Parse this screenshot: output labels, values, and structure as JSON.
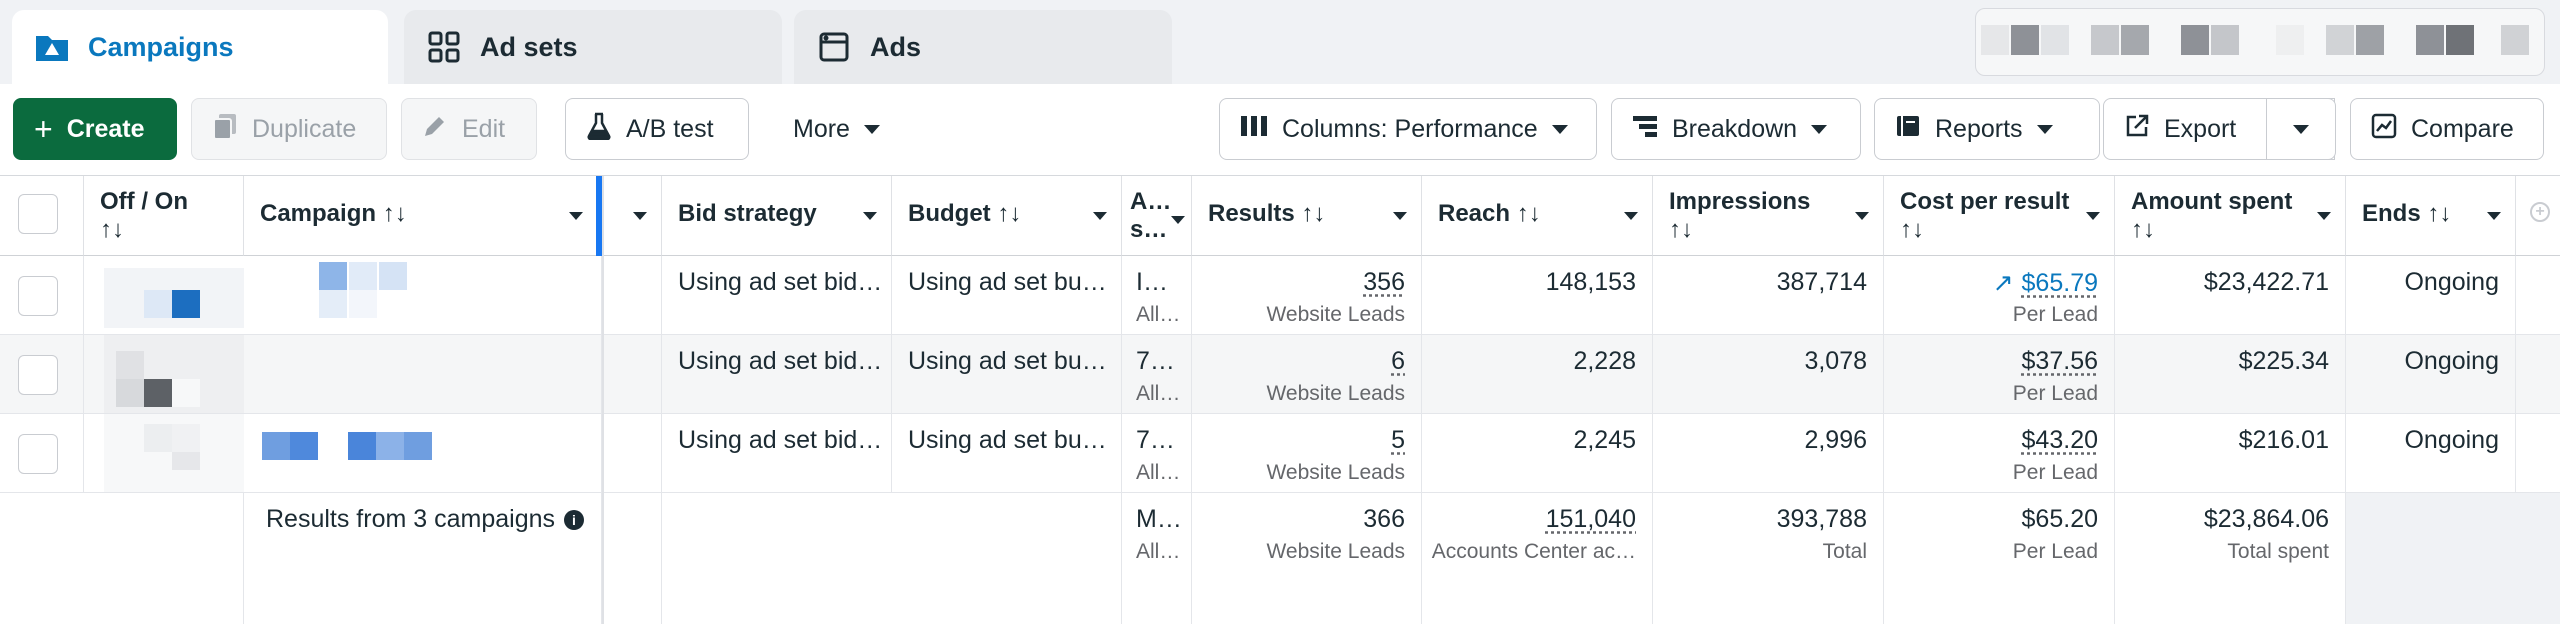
{
  "tabs": [
    {
      "label": "Campaigns",
      "icon": "campaign-folder-icon"
    },
    {
      "label": "Ad sets",
      "icon": "adsets-grid-icon"
    },
    {
      "label": "Ads",
      "icon": "ads-window-icon"
    }
  ],
  "toolbar": {
    "create": "Create",
    "duplicate": "Duplicate",
    "edit": "Edit",
    "ab_test": "A/B test",
    "more": "More",
    "columns": "Columns: Performance",
    "breakdown": "Breakdown",
    "reports": "Reports",
    "export": "Export",
    "compare": "Compare"
  },
  "table": {
    "headers": {
      "off_on": "Off / On",
      "campaign": "Campaign",
      "bid_strategy": "Bid strategy",
      "budget": "Budget",
      "attribution": "A… s…",
      "results": "Results",
      "reach": "Reach",
      "impressions": "Impressions",
      "cost_per_result": "Cost per result",
      "amount_spent": "Amount spent",
      "ends": "Ends"
    },
    "sort_glyph": "↑↓",
    "rows": [
      {
        "bid": "Using ad set bid…",
        "budget": "Using ad set bu…",
        "attr": "I…",
        "attr_sub": "All…",
        "results": "356",
        "results_sub": "Website Leads",
        "reach": "148,153",
        "impressions": "387,714",
        "cpr": "$65.79",
        "cpr_sub": "Per Lead",
        "spent": "$23,422.71",
        "ends": "Ongoing"
      },
      {
        "bid": "Using ad set bid…",
        "budget": "Using ad set bu…",
        "attr": "7…",
        "attr_sub": "All…",
        "results": "6",
        "results_sub": "Website Leads",
        "reach": "2,228",
        "impressions": "3,078",
        "cpr": "$37.56",
        "cpr_sub": "Per Lead",
        "spent": "$225.34",
        "ends": "Ongoing"
      },
      {
        "bid": "Using ad set bid…",
        "budget": "Using ad set bu…",
        "attr": "7…",
        "attr_sub": "All…",
        "results": "5",
        "results_sub": "Website Leads",
        "reach": "2,245",
        "impressions": "2,996",
        "cpr": "$43.20",
        "cpr_sub": "Per Lead",
        "spent": "$216.01",
        "ends": "Ongoing"
      }
    ],
    "summary": {
      "label": "Results from 3 campaigns",
      "attr": "M…",
      "attr_sub": "All…",
      "results": "366",
      "results_sub": "Website Leads",
      "reach": "151,040",
      "reach_sub": "Accounts Center ac…",
      "impressions": "393,788",
      "impressions_sub": "Total",
      "cpr": "$65.20",
      "cpr_sub": "Per Lead",
      "spent": "$23,864.06",
      "spent_sub": "Total spent"
    }
  },
  "colors": {
    "accent": "#0a78be",
    "create_green": "#0b6b3e",
    "separator_blue": "#1877f2"
  }
}
